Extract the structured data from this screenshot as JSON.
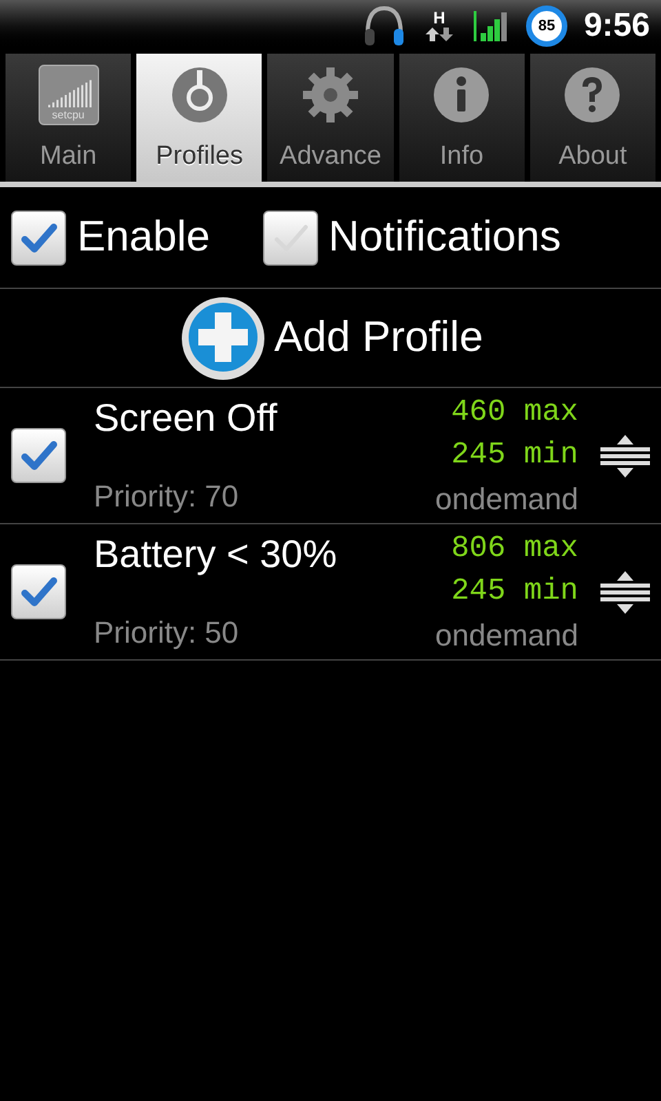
{
  "status_bar": {
    "network_type": "H",
    "battery": "85",
    "time": "9:56"
  },
  "tabs": [
    {
      "label": "Main",
      "kind": "logo",
      "logo_text": "setcpu",
      "selected": false
    },
    {
      "label": "Profiles",
      "kind": "profiles",
      "selected": true
    },
    {
      "label": "Advance",
      "kind": "gear",
      "selected": false
    },
    {
      "label": "Info",
      "kind": "info",
      "selected": false
    },
    {
      "label": "About",
      "kind": "help",
      "selected": false
    }
  ],
  "toggles": [
    {
      "label": "Enable",
      "checked": true
    },
    {
      "label": "Notifications",
      "checked": false
    }
  ],
  "add_profile": {
    "label": "Add Profile"
  },
  "profiles": [
    {
      "name": "Screen Off",
      "priority": "Priority: 70",
      "max": "460 max",
      "min": "245 min",
      "governor": "ondemand",
      "checked": true
    },
    {
      "name": "Battery < 30%",
      "priority": "Priority: 50",
      "max": "806 max",
      "min": "245 min",
      "governor": "ondemand",
      "checked": true
    }
  ]
}
